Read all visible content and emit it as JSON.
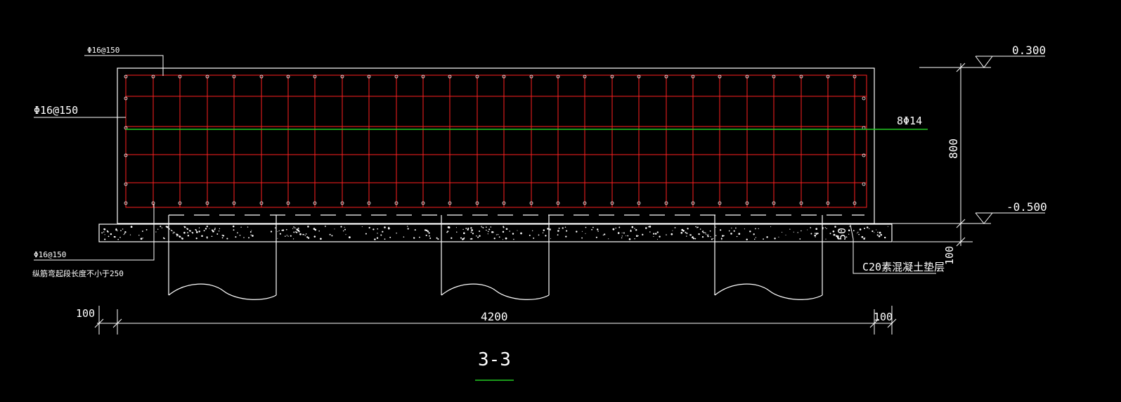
{
  "drawing": {
    "section_title": "3-3",
    "colors": {
      "background": "#000000",
      "outline": "#ffffff",
      "rebar": "#ff2020",
      "centerline": "#22cc22",
      "title_underline": "#22cc22"
    }
  },
  "labels": {
    "top_bar_callout": "Φ16@150",
    "side_bar_callout": "Φ16@150",
    "bottom_bar_callout": "Φ16@150",
    "anchorage_note": "纵筋弯起段长度不小于250",
    "long_bars": "8Φ14",
    "cushion_layer": "C20素混凝土垫层"
  },
  "levels": {
    "top": "0.300",
    "bottom": "-0.500"
  },
  "dimensions": {
    "beam_height": "800",
    "cushion_thickness": "100",
    "cover": "50",
    "overall_width": "4200",
    "left_projection": "100",
    "right_projection": "100"
  }
}
